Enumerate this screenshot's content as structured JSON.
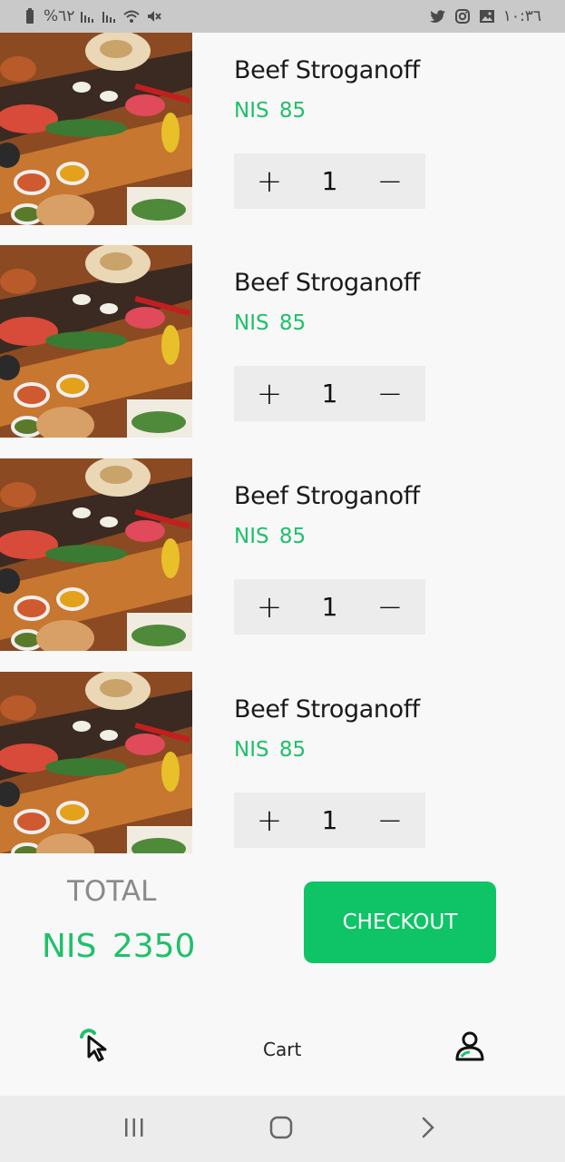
{
  "statusbar": {
    "battery": "%٦٢",
    "time": "١٠:٣٦",
    "icons": [
      "battery-icon",
      "signal-icon",
      "signal-icon",
      "wifi-icon",
      "mute-icon",
      "twitter-icon",
      "instagram-icon",
      "gallery-icon"
    ]
  },
  "cart": {
    "items": [
      {
        "name": "Beef Stroganoff",
        "currency": "NIS",
        "price": "85",
        "price_display": "NIS  85",
        "qty": "1"
      },
      {
        "name": "Beef Stroganoff",
        "currency": "NIS",
        "price": "85",
        "price_display": "NIS  85",
        "qty": "1"
      },
      {
        "name": "Beef Stroganoff",
        "currency": "NIS",
        "price": "85",
        "price_display": "NIS  85",
        "qty": "1"
      },
      {
        "name": "Beef Stroganoff",
        "currency": "NIS",
        "price": "85",
        "price_display": "NIS  85",
        "qty": "1"
      }
    ],
    "increment_label": "+",
    "decrement_label": "−"
  },
  "summary": {
    "total_label": "TOTAL",
    "total_display": "NIS  2350",
    "checkout_label": "CHECKOUT"
  },
  "tabbar": {
    "cart_label": "Cart",
    "icons": [
      "cursor-click-icon",
      "profile-icon"
    ]
  },
  "system_nav": [
    "recents-icon",
    "home-icon",
    "back-icon"
  ],
  "colors": {
    "accent": "#1fc06a",
    "button": "#0fc466",
    "stepper_bg": "#ececec",
    "statusbar": "#c9c9c9"
  }
}
